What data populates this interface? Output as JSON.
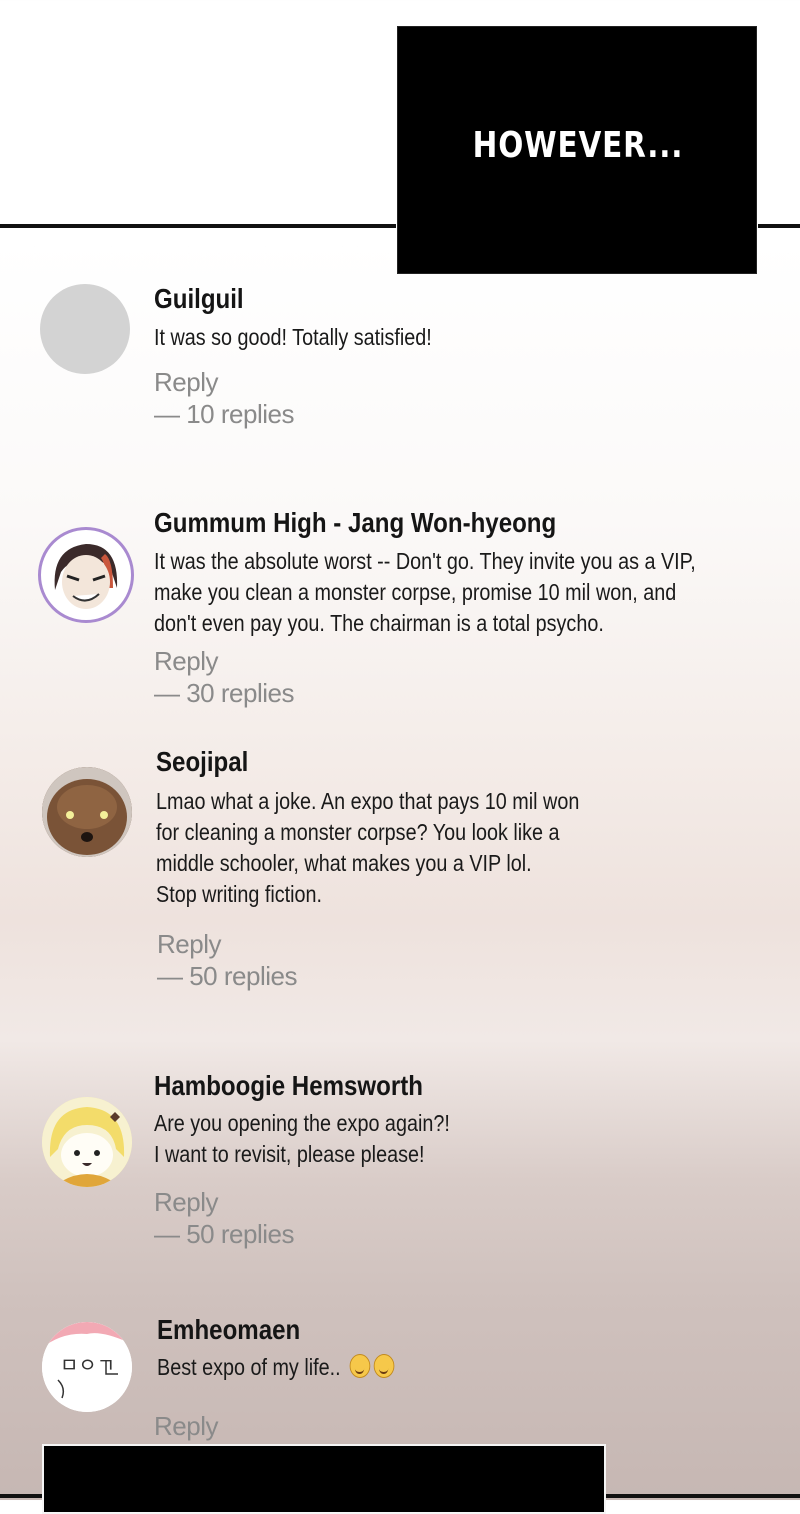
{
  "caption": {
    "text": "HOWEVER..."
  },
  "comments": [
    {
      "username": "Guilguil",
      "lines": [
        "It was so good! Totally satisfied!"
      ],
      "reply_label": "Reply",
      "replies_label": "— 10 replies",
      "avatar": "blank-gray-avatar"
    },
    {
      "username": "Gummum High - Jang Won-hyeong",
      "lines": [
        "It was the absolute worst -- Don't go. They invite you as a VIP,",
        "make you clean a monster corpse, promise 10 mil won, and",
        "don't even pay you. The chairman is a total psycho."
      ],
      "reply_label": "Reply",
      "replies_label": "— 30 replies",
      "avatar": "grinning-man-avatar"
    },
    {
      "username": "Seojipal",
      "lines": [
        "Lmao what a joke. An expo that pays 10 mil won",
        "for cleaning a monster corpse? You look like a",
        "middle schooler, what makes you a VIP lol.",
        "Stop writing fiction."
      ],
      "reply_label": "Reply",
      "replies_label": "— 50 replies",
      "avatar": "brown-poodle-avatar"
    },
    {
      "username": "Hamboogie Hemsworth",
      "lines": [
        "Are you opening the expo again?!",
        "I want to revisit, please please!"
      ],
      "reply_label": "Reply",
      "replies_label": "— 50 replies",
      "avatar": "blonde-girl-cartoon-avatar"
    },
    {
      "username": "Emheomaen",
      "lines": [
        "Best expo of my life.."
      ],
      "reply_label": "Reply",
      "avatar": "doodle-face-avatar",
      "emoji_icons": [
        "smiling-face-icon",
        "smiling-face-icon"
      ]
    }
  ],
  "colors": {
    "caption_bg": "#000000",
    "caption_text": "#ffffff",
    "username": "#151515",
    "body": "#1a1a1a",
    "reply": "#8a8a8a"
  }
}
